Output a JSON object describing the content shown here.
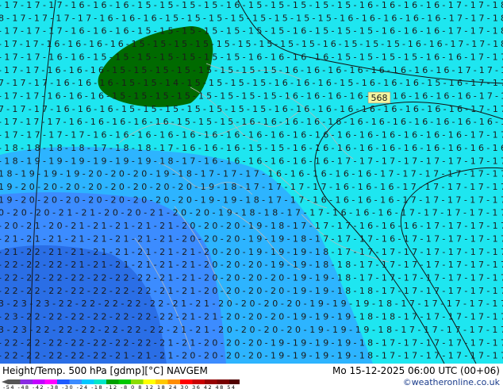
{
  "title": "Height/Temp. 500 hPa [gdmp][°C] NAVGEM",
  "datetime": "Mo 15-12-2025 06:00 UTC (00+06)",
  "credit": "©weatheronline.co.uk",
  "contour_label": "568",
  "legend": {
    "values": [
      "-54",
      "-48",
      "-42",
      "-38",
      "-30",
      "-24",
      "-18",
      "-12",
      "-8",
      "0",
      "8",
      "12",
      "18",
      "24",
      "30",
      "36",
      "42",
      "48",
      "54"
    ],
    "colors": [
      "#555555",
      "#8a2be2",
      "#c300ff",
      "#ff00ff",
      "#1e5aff",
      "#3c8cff",
      "#00c8ff",
      "#00e6c8",
      "#00a000",
      "#00c800",
      "#8cdc00",
      "#ffff00",
      "#ffc800",
      "#ff8c00",
      "#ff0000",
      "#c80000",
      "#960000",
      "#780000",
      "#500000"
    ]
  },
  "colors": {
    "cyan": "#1ee6f0",
    "light_blue": "#2db4ff",
    "mid_blue": "#3c8cff",
    "deep_blue": "#2a6ee6",
    "green": "#006a00"
  },
  "grid_rows": [
    "-17-17-17-16-16-16-15-15-15-15-16-15-15-15-15-15-16-16-16-16-17-17-18",
    "8-17-17-17-17-16-16-16-15-15-15-15-15-15-15-15-16-16-16-16-16-17-17-18",
    "-17-17-17-16-16-16-15-15-15-15-15-15-15-16-15-15-15-16-16-16-17-17-18",
    "-17-17-16-16-16-16-15-15-15-15-15-15-15-15-15-16-15-15-15-16-16-17-17-18",
    "-17-17-16-16-15-15-15-15-15-15-15-16-16-16-16-15-15-15-15-16-16-17-17",
    "-17-17-16-16-16-15-15-15-15-15-15-15-15-16-16-16-16-16-16-16-16-17-17-1",
    "7-17-17-16-16-16-15-15-14-15-15-15-15-16-16-16-15-16-16-16-15-16-17-17",
    "-17-17-16-16-16-15-15-15-15-15-15-15-15-16-16-16-16-16-16-16-16-16-17-1",
    "7-17-17-16-16-16-15-15-15-15-15-15-15-16-16-16-16-16-16-16-16-16-17-17",
    "-17-17-17-16-16-16-16-16-15-15-15-16-16-16-16-16-16-16-16-16-16-16-16-1",
    "-17-17-17-17-16-16-16-16-16-16-16-16-16-16-16-16-16-16-16-16-16-17-17",
    "-18-18-18-18-17-18-18-17-16-16-16-15-15-16-16-16-16-16-16-16-16-16-16",
    "-18-19-19-19-19-19-19-18-17-16-16-16-16-16-16-17-17-17-17-17-17-17-17",
    "18-19-19-19-20-20-20-19-18-17-17-17-16-16-16-16-16-17-17-17-17-17-17",
    "19-20-20-20-20-20-20-20-20-19-18-17-17-17-17-16-16-16-17-17-17-17-17",
    "19-20-20-20-20-20-20-20-20-19-19-18-17-17-16-16-16-16-17-17-17-17-17",
    "0-20-20-21-21-20-20-21-20-20-19-18-18-17-17-16-16-16-17-17-17-17-17",
    "-20-21-20-21-21-21-21-21-20-20-20-19-18-17-17-17-16-16-16-17-17-17-17",
    "-21-21-21-21-21-21-21-21-20-20-20-19-19-18-17-17-17-16-17-17-17-17-17",
    "-21-22-21-21-21-21-21-21-21-20-20-19-19-19-18-17-17-17-17-17-17-17-17",
    "-22-22-22-21-21-21-21-21-21-20-20-20-19-19-18-18-17-17-17-17-17-17-17",
    "-22-22-22-22-22-22-22-21-21-20-20-20-20-19-19-18-17-17-17-17-17-17-17",
    "-22-22-22-22-22-22-22-21-21-20-20-20-20-19-19-18-18-17-17-17-17-17-17",
    "3-23-23-22-22-22-22-22-21-21-20-20-20-20-19-19-19-18-17-17-17-17-17",
    "-23-22-22-22-22-22-22-22-21-21-20-20-20-19-19-19-18-18-17-17-17-17-17",
    "3-23-22-22-22-22-22-22-21-21-20-20-20-20-19-19-19-18-17-17-17-17-17",
    "-22-22-22-22-22-22-22-21-21-20-20-20-19-19-19-19-18-17-17-17-17-17-17",
    "-22-22-22-22-22-21-21-21-20-20-20-20-19-19-19-19-18-17-17-17-17-17-17"
  ]
}
